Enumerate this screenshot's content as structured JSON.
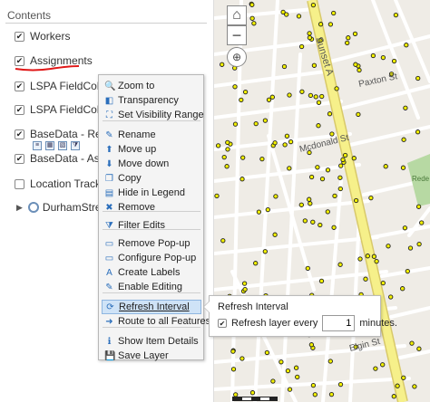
{
  "panel": {
    "title": "Contents"
  },
  "layers": [
    {
      "label": "Workers",
      "checked": "✔"
    },
    {
      "label": "Assignments",
      "checked": "✔"
    },
    {
      "label": "LSPA FieldCollector",
      "checked": "✔"
    },
    {
      "label": "LSPA FieldCollector",
      "checked": "✔"
    },
    {
      "label": "BaseData - Regional",
      "checked": "✔"
    },
    {
      "label": "BaseData - Assessm",
      "checked": "✔"
    },
    {
      "label": "Location Tracking",
      "checked": ""
    },
    {
      "label": "DurhamStreetUT",
      "checked": ""
    }
  ],
  "menu": {
    "items": [
      {
        "label": "Zoom to",
        "icon": "zoom-icon",
        "glyph": "🔍"
      },
      {
        "label": "Transparency",
        "icon": "transparency-icon",
        "glyph": "◧"
      },
      {
        "label": "Set Visibility Range",
        "icon": "visibility-range-icon",
        "glyph": "⛶"
      },
      {
        "label": "Rename",
        "icon": "rename-icon",
        "glyph": "✎"
      },
      {
        "label": "Move up",
        "icon": "arrow-up-icon",
        "glyph": "⬆"
      },
      {
        "label": "Move down",
        "icon": "arrow-down-icon",
        "glyph": "⬇"
      },
      {
        "label": "Copy",
        "icon": "copy-icon",
        "glyph": "❐"
      },
      {
        "label": "Hide in Legend",
        "icon": "hide-legend-icon",
        "glyph": "▤"
      },
      {
        "label": "Remove",
        "icon": "remove-icon",
        "glyph": "✖"
      },
      {
        "label": "Filter Edits",
        "icon": "filter-icon",
        "glyph": "⧩"
      },
      {
        "label": "Remove Pop-up",
        "icon": "remove-popup-icon",
        "glyph": "▭"
      },
      {
        "label": "Configure Pop-up",
        "icon": "configure-popup-icon",
        "glyph": "▭"
      },
      {
        "label": "Create Labels",
        "icon": "labels-icon",
        "glyph": "A"
      },
      {
        "label": "Enable Editing",
        "icon": "edit-icon",
        "glyph": "✎"
      },
      {
        "label": "Refresh Interval",
        "icon": "refresh-icon",
        "glyph": "⟳"
      },
      {
        "label": "Route to all Features",
        "icon": "route-icon",
        "glyph": "➜"
      },
      {
        "label": "Show Item Details",
        "icon": "details-icon",
        "glyph": "ℹ"
      },
      {
        "label": "Save Layer",
        "icon": "save-icon",
        "glyph": "💾"
      }
    ]
  },
  "refresh_popup": {
    "title": "Refresh Interval",
    "checkbox_label": "Refresh layer every",
    "checked": "✔",
    "minutes_value": "1",
    "unit_label": "minutes."
  },
  "map": {
    "street_labels": [
      "Sunset A",
      "Paxton St",
      "Mcdonald St",
      "Elgin St"
    ],
    "park_label": "Rede Park",
    "colors": {
      "background": "#efece6",
      "street": "#ffffff",
      "main_road": "#f6f08a",
      "park": "#b7d9a3",
      "point_fill": "#f2f000",
      "point_stroke": "#222222"
    }
  }
}
